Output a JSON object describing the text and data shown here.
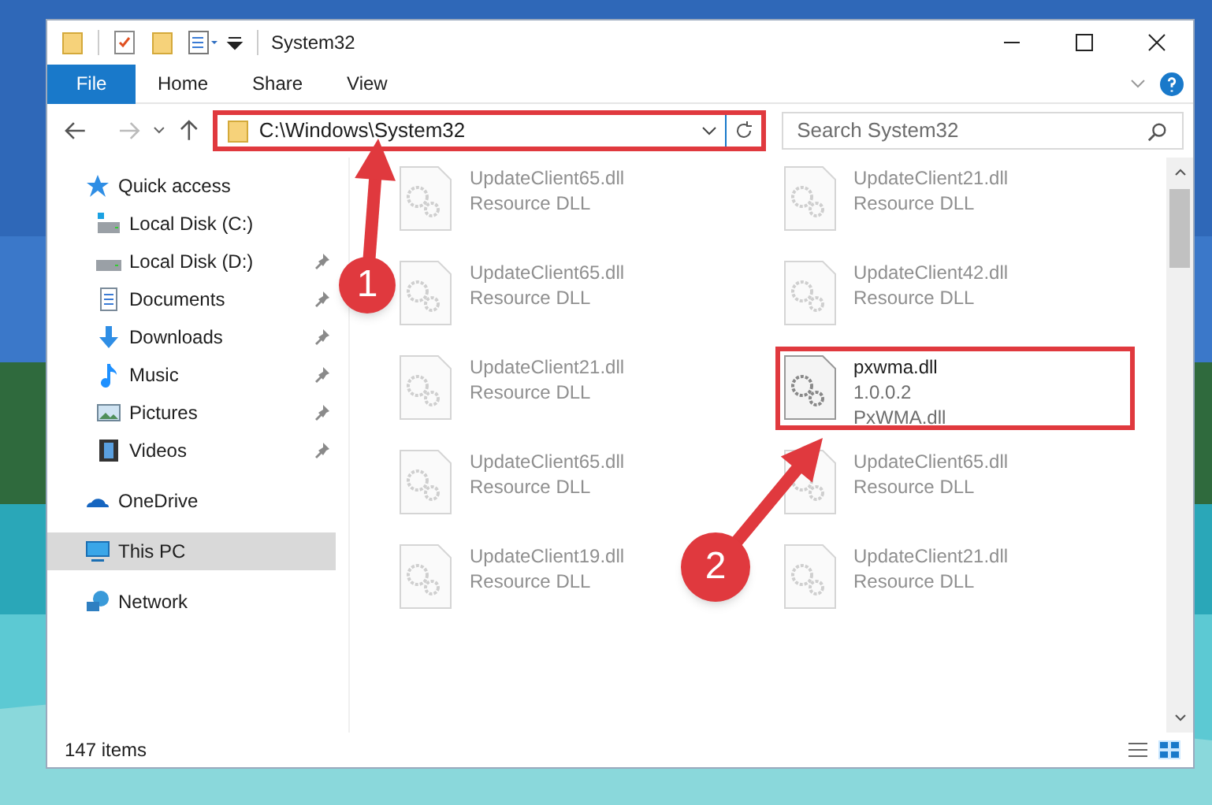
{
  "window": {
    "title": "System32"
  },
  "ribbon_tabs": [
    {
      "label": "File",
      "selected": true
    },
    {
      "label": "Home",
      "selected": false
    },
    {
      "label": "Share",
      "selected": false
    },
    {
      "label": "View",
      "selected": false
    }
  ],
  "address_bar": {
    "path": "C:\\Windows\\System32",
    "highlighted": true
  },
  "search": {
    "placeholder": "Search System32"
  },
  "sidebar": {
    "items": [
      {
        "label": "Quick access",
        "kind": "star",
        "selected": false,
        "pinned": false,
        "children": [
          {
            "label": "Local Disk (C:)",
            "kind": "drive-c",
            "selected": false,
            "pinned": false
          },
          {
            "label": "Local Disk (D:)",
            "kind": "drive",
            "selected": false,
            "pinned": true
          },
          {
            "label": "Documents",
            "kind": "documents",
            "selected": false,
            "pinned": true
          },
          {
            "label": "Downloads",
            "kind": "downloads",
            "selected": false,
            "pinned": true
          },
          {
            "label": "Music",
            "kind": "music",
            "selected": false,
            "pinned": true
          },
          {
            "label": "Pictures",
            "kind": "pictures",
            "selected": false,
            "pinned": true
          },
          {
            "label": "Videos",
            "kind": "videos",
            "selected": false,
            "pinned": true
          }
        ]
      },
      {
        "label": "OneDrive",
        "kind": "cloud",
        "selected": false,
        "pinned": false
      },
      {
        "label": "This PC",
        "kind": "pc",
        "selected": true,
        "pinned": false
      },
      {
        "label": "Network",
        "kind": "network",
        "selected": false,
        "pinned": false
      }
    ]
  },
  "files": [
    {
      "name": "UpdateClient65.dll",
      "lines": [
        "Resource DLL"
      ],
      "blurred": true,
      "highlighted": false
    },
    {
      "name": "UpdateClient21.dll",
      "lines": [
        "Resource DLL"
      ],
      "blurred": true,
      "highlighted": false
    },
    {
      "name": "UpdateClient65.dll",
      "lines": [
        "Resource DLL"
      ],
      "blurred": true,
      "highlighted": false
    },
    {
      "name": "UpdateClient42.dll",
      "lines": [
        "Resource DLL"
      ],
      "blurred": true,
      "highlighted": false
    },
    {
      "name": "UpdateClient21.dll",
      "lines": [
        "Resource DLL"
      ],
      "blurred": true,
      "highlighted": false
    },
    {
      "name": "pxwma.dll",
      "lines": [
        "1.0.0.2",
        "PxWMA.dll"
      ],
      "blurred": false,
      "highlighted": true
    },
    {
      "name": "UpdateClient65.dll",
      "lines": [
        "Resource DLL"
      ],
      "blurred": true,
      "highlighted": false
    },
    {
      "name": "UpdateClient65.dll",
      "lines": [
        "Resource DLL"
      ],
      "blurred": true,
      "highlighted": false
    },
    {
      "name": "UpdateClient19.dll",
      "lines": [
        "Resource DLL"
      ],
      "blurred": true,
      "highlighted": false
    },
    {
      "name": "UpdateClient21.dll",
      "lines": [
        "Resource DLL"
      ],
      "blurred": true,
      "highlighted": false
    }
  ],
  "status_bar": {
    "count": "147 items"
  },
  "annotations": [
    {
      "number": "1"
    },
    {
      "number": "2"
    }
  ]
}
